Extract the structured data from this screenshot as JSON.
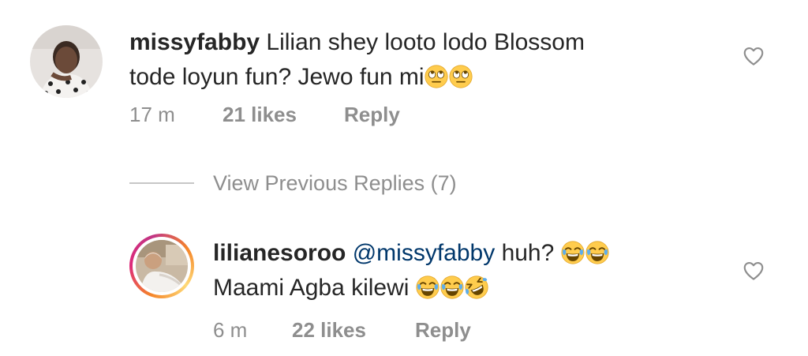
{
  "comments": [
    {
      "username": "missyfabby",
      "text_line1": "Lilian shey looto lodo Blossom",
      "text_line2": "tode loyun fun? Jewo fun mi",
      "emojis": [
        "face-with-rolling-eyes",
        "face-with-rolling-eyes"
      ],
      "time": "17 m",
      "likes": "21 likes",
      "reply_label": "Reply"
    }
  ],
  "view_previous_replies": "View Previous Replies (7)",
  "reply": {
    "username": "lilianesoroo",
    "mention": "@missyfabby",
    "text_line1": "huh?",
    "emojis_line1": [
      "face-with-tears-of-joy",
      "face-with-tears-of-joy"
    ],
    "text_line2": "Maami Agba kilewi",
    "emojis_line2": [
      "face-with-tears-of-joy",
      "face-with-tears-of-joy",
      "rolling-on-the-floor-laughing"
    ],
    "time": "6 m",
    "likes": "22 likes",
    "reply_label": "Reply"
  },
  "colors": {
    "text": "#262626",
    "meta": "#8e8e8e",
    "mention": "#00376b",
    "emoji_face": "#ffcc4d",
    "tears": "#5dadec"
  }
}
